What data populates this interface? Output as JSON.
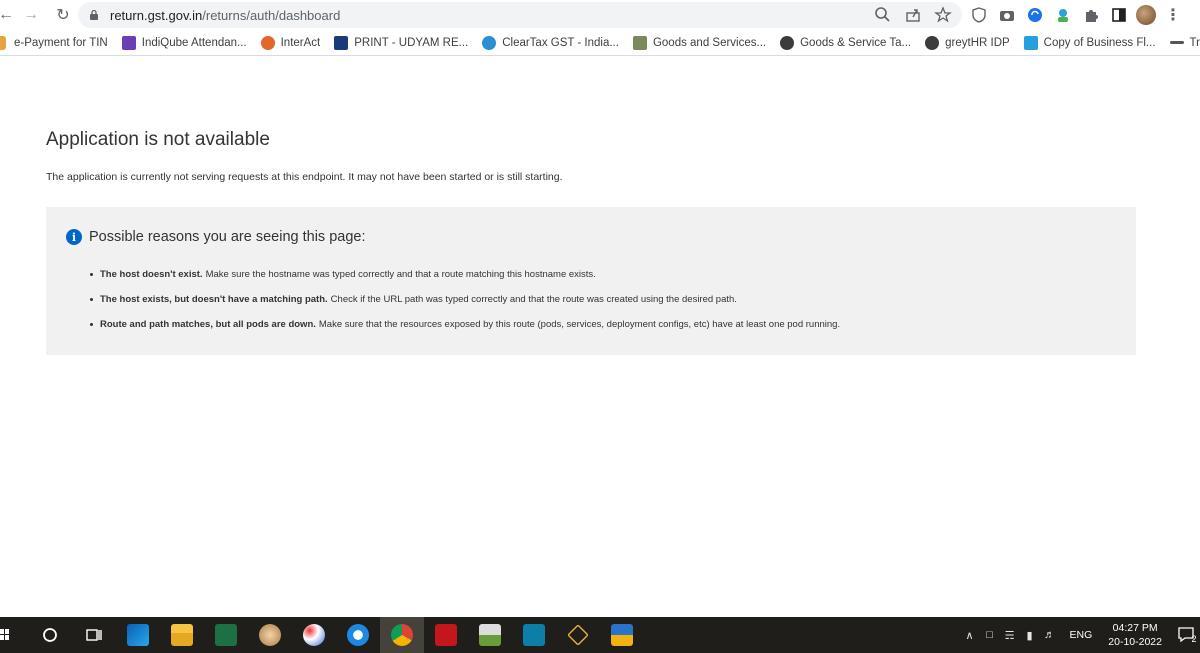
{
  "browser": {
    "url_host": "return.gst.gov.in",
    "url_path": "/returns/auth/dashboard"
  },
  "bookmarks": [
    {
      "label": "e-Payment for TIN",
      "color": "#e8a33d"
    },
    {
      "label": "IndiQube Attendan...",
      "color": "#6a3fb5"
    },
    {
      "label": "InterAct",
      "color": "#e2672a"
    },
    {
      "label": "PRINT - UDYAM RE...",
      "color": "#1b3a7a"
    },
    {
      "label": "ClearTax GST - India...",
      "color": "#2b8fd6"
    },
    {
      "label": "Goods and Services...",
      "color": "#7a8a5a"
    },
    {
      "label": "Goods & Service Ta...",
      "color": "#3c3c3c"
    },
    {
      "label": "greytHR IDP",
      "color": "#3c3c3c"
    },
    {
      "label": "Copy of Business Fl...",
      "color": "#25a0da"
    },
    {
      "label": "Trumarx",
      "color": "#555555"
    }
  ],
  "page": {
    "title": "Application is not available",
    "description": "The application is currently not serving requests at this endpoint. It may not have been started or is still starting.",
    "panel_title": "Possible reasons you are seeing this page:",
    "reasons": [
      {
        "bold": "The host doesn't exist.",
        "text": "Make sure the hostname was typed correctly and that a route matching this hostname exists."
      },
      {
        "bold": "The host exists, but doesn't have a matching path.",
        "text": "Check if the URL path was typed correctly and that the route was created using the desired path."
      },
      {
        "bold": "Route and path matches, but all pods are down.",
        "text": "Make sure that the resources exposed by this route (pods, services, deployment configs, etc) have at least one pod running."
      }
    ]
  },
  "taskbar": {
    "language": "ENG",
    "time": "04:27 PM",
    "date": "20-10-2022",
    "notification_count": "2"
  },
  "colors": {
    "info_blue": "#0066cc",
    "panel_bg": "#f1f1f1",
    "taskbar_bg": "#201e1a"
  }
}
